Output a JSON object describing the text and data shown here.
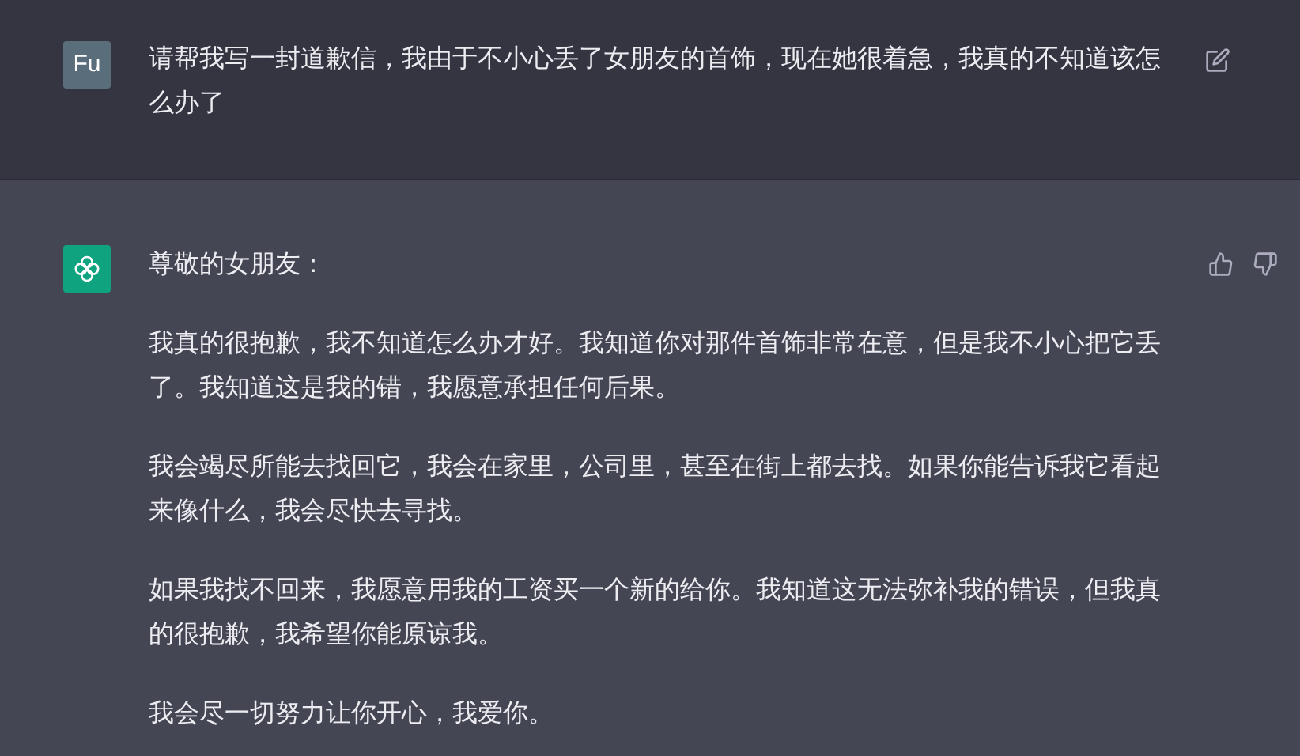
{
  "messages": [
    {
      "kind": "user",
      "avatar": "Fu",
      "text": "请帮我写一封道歉信，我由于不小心丢了女朋友的首饰，现在她很着急，我真的不知道该怎么办了"
    },
    {
      "kind": "assistant",
      "paragraphs": [
        "尊敬的女朋友：",
        "我真的很抱歉，我不知道怎么办才好。我知道你对那件首饰非常在意，但是我不小心把它丢了。我知道这是我的错，我愿意承担任何后果。",
        "我会竭尽所能去找回它，我会在家里，公司里，甚至在街上都去找。如果你能告诉我它看起来像什么，我会尽快去寻找。",
        "如果我找不回来，我愿意用我的工资买一个新的给你。我知道这无法弥补我的错误，但我真的很抱歉，我希望你能原谅我。",
        "我会尽一切努力让你开心，我爱你。"
      ]
    }
  ]
}
